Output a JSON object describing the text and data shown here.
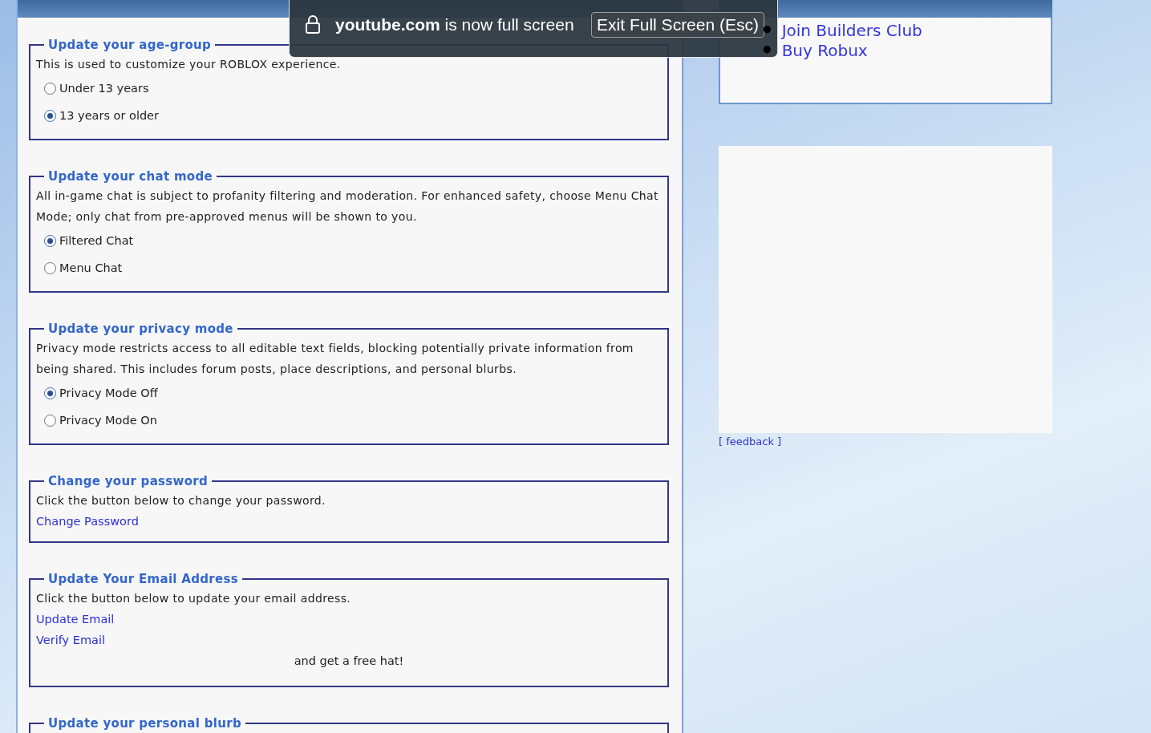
{
  "main": {
    "sections": [
      {
        "kind": "radio",
        "legend": "Update your age-group",
        "description": "This is used to customize your ROBLOX experience.",
        "options": [
          {
            "label": "Under 13 years",
            "selected": false
          },
          {
            "label": "13 years or older",
            "selected": true
          }
        ]
      },
      {
        "kind": "radio",
        "legend": "Update your chat mode",
        "description": "All in-game chat is subject to profanity filtering and moderation. For enhanced safety, choose Menu Chat Mode; only chat from pre-approved menus will be shown to you.",
        "options": [
          {
            "label": "Filtered Chat",
            "selected": true
          },
          {
            "label": "Menu Chat",
            "selected": false
          }
        ]
      },
      {
        "kind": "radio",
        "legend": "Update your privacy mode",
        "description": "Privacy mode restricts access to all editable text fields, blocking potentially private information from being shared. This includes forum posts, place descriptions, and personal blurbs.",
        "options": [
          {
            "label": "Privacy Mode Off",
            "selected": true
          },
          {
            "label": "Privacy Mode On",
            "selected": false
          }
        ]
      },
      {
        "kind": "links",
        "legend": "Change your password",
        "description": "Click the button below to change your password.",
        "links": [
          "Change Password"
        ]
      },
      {
        "kind": "links",
        "legend": "Update Your Email Address",
        "description": "Click the button below to update your email address.",
        "links": [
          "Update Email",
          "Verify Email"
        ],
        "note": "and get a free hat!"
      },
      {
        "kind": "header",
        "legend": "Update your personal blurb"
      }
    ]
  },
  "sidebar": {
    "links": [
      {
        "marker": "•",
        "label": "Join Builders Club"
      },
      {
        "marker": "•",
        "label": "Buy Robux"
      }
    ],
    "feedback": "[ feedback ]"
  },
  "fullscreen_notice": {
    "message": "**youtube.com** is now full screen",
    "button": "Exit Full Screen (Esc)"
  }
}
